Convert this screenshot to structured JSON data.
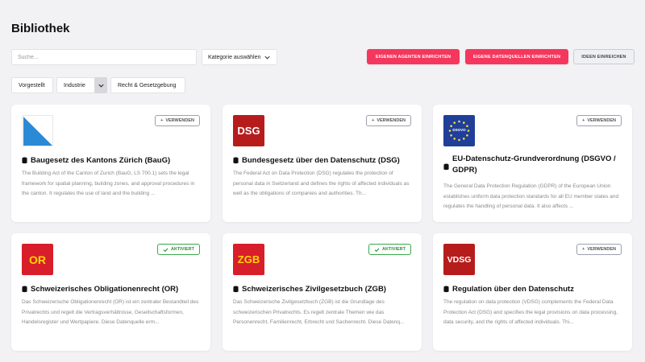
{
  "page": {
    "title": "Bibliothek"
  },
  "toolbar": {
    "search_placeholder": "Suche...",
    "category_select": "Kategorie auswählen",
    "btn_agent": "EIGENEN AGENTEN EINRICHTEN",
    "btn_datasource": "EIGENE DATENQUELLEN EINRICHTEN",
    "btn_ideas": "IDEEN EINREICHEN"
  },
  "filters": {
    "featured": "Vorgestellt",
    "industry": "Industrie",
    "law": "Recht & Gesetzgebung"
  },
  "colors": {
    "accent": "#f5375d",
    "active_green": "#2e8f3c"
  },
  "cards": [
    {
      "logo": "baug-triangle-logo",
      "status": "VERWENDEN",
      "title": "Baugesetz des Kantons Zürich (BauG)",
      "description": "The Building Act of the Canton of Zurich (BauG, LS 700.1) sets the legal framework for spatial planning, building zones, and approval procedures in the canton. It regulates the use of land and the building ..."
    },
    {
      "logo_text": "DSG",
      "status": "VERWENDEN",
      "title": "Bundesgesetz über den Datenschutz (DSG)",
      "description": "The Federal Act on Data Protection (DSG) regulates the protection of personal data in Switzerland and defines the rights of affected individuals as well as the obligations of companies and authorities. Th..."
    },
    {
      "logo_text": "DSGVO",
      "status": "VERWENDEN",
      "title": "EU-Datenschutz-Grundverordnung (DSGVO / GDPR)",
      "description": "The General Data Protection Regulation (GDPR) of the European Union establishes uniform data protection standards for all EU member states and regulates the handling of personal data. It also affects ..."
    },
    {
      "logo_text": "OR",
      "status": "AKTIVIERT",
      "title": "Schweizerisches Obligationenrecht (OR)",
      "description": "Das Schweizerische Obligationenrecht (OR) ist ein zentraler Bestandteil des Privatrechts und regelt die Vertragsverhältnisse, Gesellschaftsformen, Handelsregister und Wertpapiere. Diese Datenquelle erm..."
    },
    {
      "logo_text": "ZGB",
      "status": "AKTIVIERT",
      "title": "Schweizerisches Zivilgesetzbuch (ZGB)",
      "description": "Das Schweizerische Zivilgesetzbuch (ZGB) ist die Grundlage des schweizerischen Privatrechts. Es regelt zentrale Themen wie das Personenrecht, Familienrecht, Erbrecht und Sachenrecht. Diese Datenq..."
    },
    {
      "logo_text": "VDSG",
      "status": "VERWENDEN",
      "title": "Regulation über den Datenschutz",
      "description": "The regulation on data protection (VDSG) complements the Federal Data Protection Act (DSG) and specifies the legal provisions on data processing, data security, and the rights of affected individuals. Thi..."
    }
  ]
}
